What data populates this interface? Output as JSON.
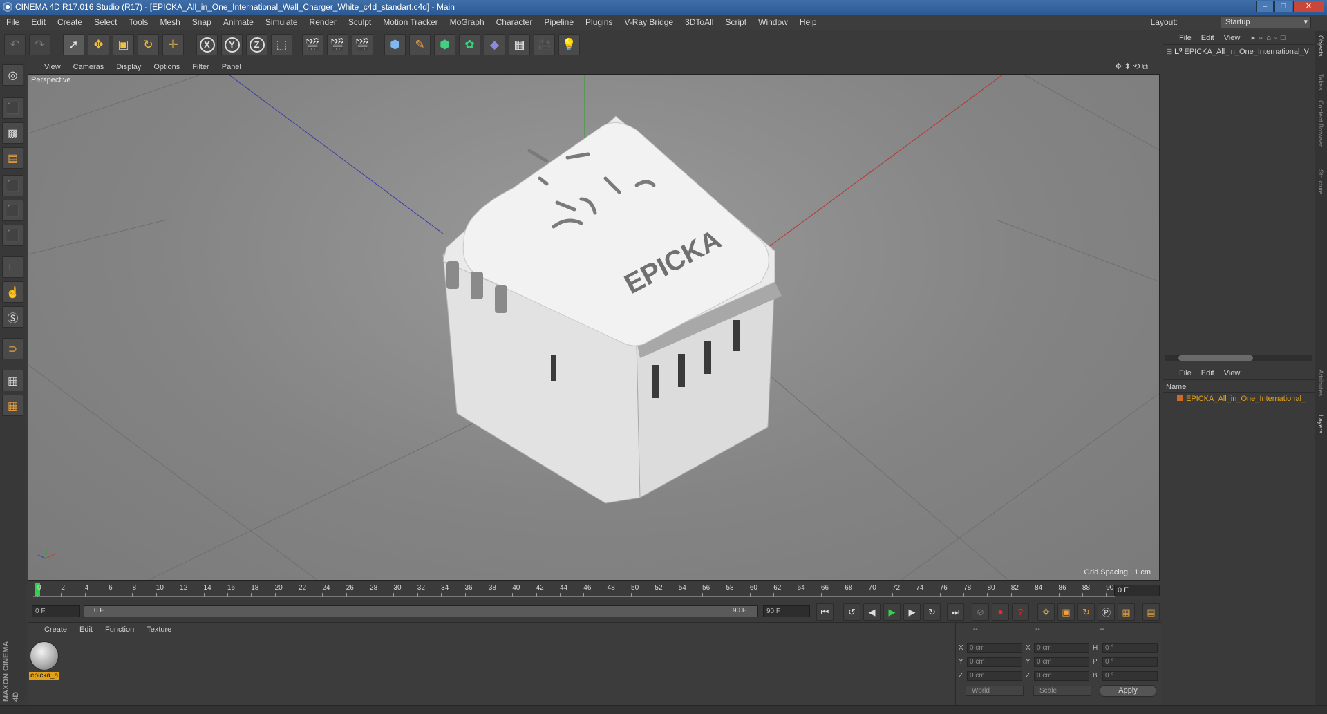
{
  "window": {
    "title": "CINEMA 4D R17.016 Studio (R17) - [EPICKA_All_in_One_International_Wall_Charger_White_c4d_standart.c4d] - Main"
  },
  "menubar": {
    "items": [
      "File",
      "Edit",
      "Create",
      "Select",
      "Tools",
      "Mesh",
      "Snap",
      "Animate",
      "Simulate",
      "Render",
      "Sculpt",
      "Motion Tracker",
      "MoGraph",
      "Character",
      "Pipeline",
      "Plugins",
      "V-Ray Bridge",
      "3DToAll",
      "Script",
      "Window",
      "Help"
    ]
  },
  "layout": {
    "label": "Layout:",
    "value": "Startup"
  },
  "toolbar": {
    "x_label": "X",
    "y_label": "Y",
    "z_label": "Z"
  },
  "viewport": {
    "menu": [
      "View",
      "Cameras",
      "Display",
      "Options",
      "Filter",
      "Panel"
    ],
    "label": "Perspective",
    "grid_spacing": "Grid Spacing : 1 cm",
    "model_brand": "EPICKA"
  },
  "timeline": {
    "ticks": [
      "0",
      "2",
      "4",
      "6",
      "8",
      "10",
      "12",
      "14",
      "16",
      "18",
      "20",
      "22",
      "24",
      "26",
      "28",
      "30",
      "32",
      "34",
      "36",
      "38",
      "40",
      "42",
      "44",
      "46",
      "48",
      "50",
      "52",
      "54",
      "56",
      "58",
      "60",
      "62",
      "64",
      "66",
      "68",
      "70",
      "72",
      "74",
      "76",
      "78",
      "80",
      "82",
      "84",
      "86",
      "88",
      "90"
    ],
    "current_frame": "0 F",
    "start": "0 F",
    "range_start": "0 F",
    "range_end": "90 F",
    "end": "90 F"
  },
  "material_manager": {
    "menu": [
      "Create",
      "Edit",
      "Function",
      "Texture"
    ],
    "materials": [
      {
        "name": "epicka_a"
      }
    ]
  },
  "coordinates": {
    "headers": [
      "--",
      "--",
      "--"
    ],
    "rows": [
      {
        "a": "X",
        "av": "0 cm",
        "b": "X",
        "bv": "0 cm",
        "c": "H",
        "cv": "0 °"
      },
      {
        "a": "Y",
        "av": "0 cm",
        "b": "Y",
        "bv": "0 cm",
        "c": "P",
        "cv": "0 °"
      },
      {
        "a": "Z",
        "av": "0 cm",
        "b": "Z",
        "bv": "0 cm",
        "c": "B",
        "cv": "0 °"
      }
    ],
    "mode1": "World",
    "mode2": "Scale",
    "apply": "Apply"
  },
  "object_manager": {
    "menu": [
      "File",
      "Edit",
      "View"
    ],
    "objects": [
      "EPICKA_All_in_One_International_V"
    ]
  },
  "layer_manager": {
    "menu": [
      "File",
      "Edit",
      "View"
    ],
    "column": "Name",
    "layers": [
      "EPICKA_All_in_One_International_"
    ]
  },
  "side_tabs": [
    "Objects",
    "Takes",
    "Content Browser",
    "Structure",
    "Attributes",
    "Layers"
  ],
  "maxon": "MAXON CINEMA 4D"
}
